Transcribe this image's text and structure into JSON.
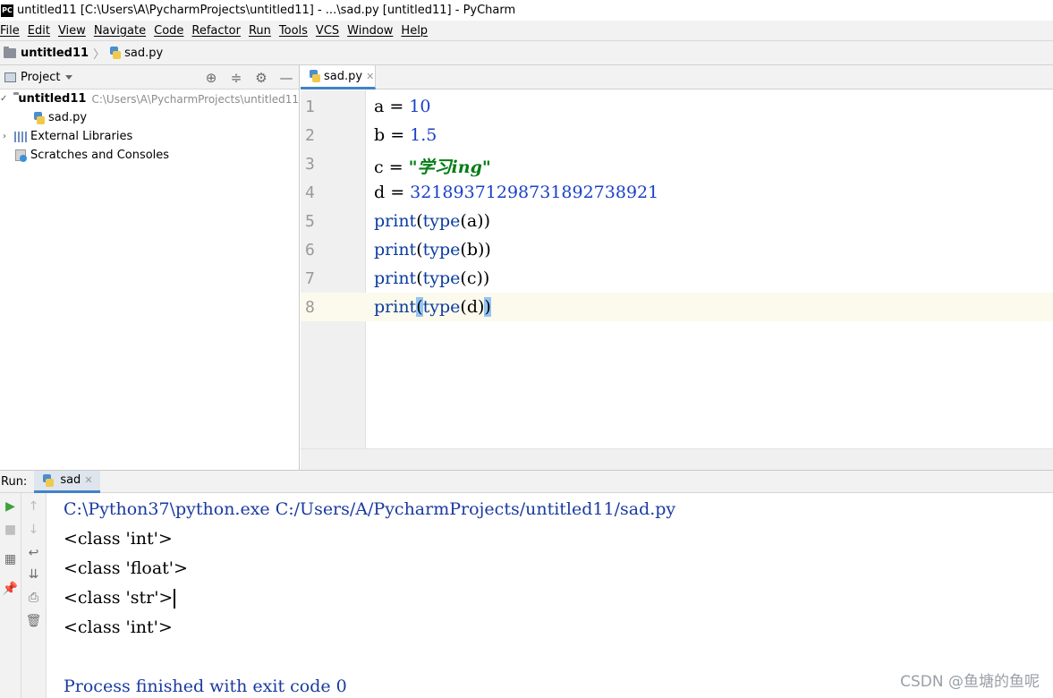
{
  "window": {
    "logo_text": "PC",
    "title": "untitled11 [C:\\Users\\A\\PycharmProjects\\untitled11] - ...\\sad.py [untitled11] - PyCharm"
  },
  "menu": [
    "File",
    "Edit",
    "View",
    "Navigate",
    "Code",
    "Refactor",
    "Run",
    "Tools",
    "VCS",
    "Window",
    "Help"
  ],
  "breadcrumb": {
    "project": "untitled11",
    "file": "sad.py"
  },
  "project_panel": {
    "title": "Project",
    "tree": {
      "root_name": "untitled11",
      "root_path": "C:\\Users\\A\\PycharmProjects\\untitled11",
      "file": "sad.py",
      "libraries": "External Libraries",
      "scratches": "Scratches and Consoles"
    }
  },
  "editor": {
    "tab_label": "sad.py",
    "line_numbers": [
      "1",
      "2",
      "3",
      "4",
      "5",
      "6",
      "7",
      "8"
    ],
    "lines": {
      "l1": {
        "name": "a",
        "op": " = ",
        "value": "10"
      },
      "l2": {
        "name": "b",
        "op": " = ",
        "value": "1.5"
      },
      "l3": {
        "name": "c",
        "op": " = ",
        "value": "\"学习ing\""
      },
      "l4": {
        "name": "d",
        "op": " = ",
        "value": "32189371298731892738921"
      },
      "l5": {
        "fn": "print",
        "open": "(",
        "inner_fn": "type",
        "inner": "(a)",
        "close": ")"
      },
      "l6": {
        "fn": "print",
        "open": "(",
        "inner_fn": "type",
        "inner": "(b)",
        "close": ")"
      },
      "l7": {
        "fn": "print",
        "open": "(",
        "inner_fn": "type",
        "inner": "(c)",
        "close": ")"
      },
      "l8": {
        "fn": "print",
        "open": "(",
        "inner_fn": "type",
        "inner": "(d)",
        "close": ")"
      }
    }
  },
  "run_panel": {
    "label": "Run:",
    "tab_label": "sad",
    "output": [
      "C:\\Python37\\python.exe C:/Users/A/PycharmProjects/untitled11/sad.py",
      "<class 'int'>",
      "<class 'float'>",
      "<class 'str'>",
      "<class 'int'>",
      "",
      "Process finished with exit code 0"
    ]
  },
  "watermark": "CSDN @鱼塘的鱼呢",
  "colors": {
    "number": "#1b40c8",
    "string": "#067d17",
    "builtin": "#0a3c9e",
    "current_line": "#fcfaed",
    "bracket_highlight": "#93c5f5",
    "accent": "#4083c9"
  }
}
